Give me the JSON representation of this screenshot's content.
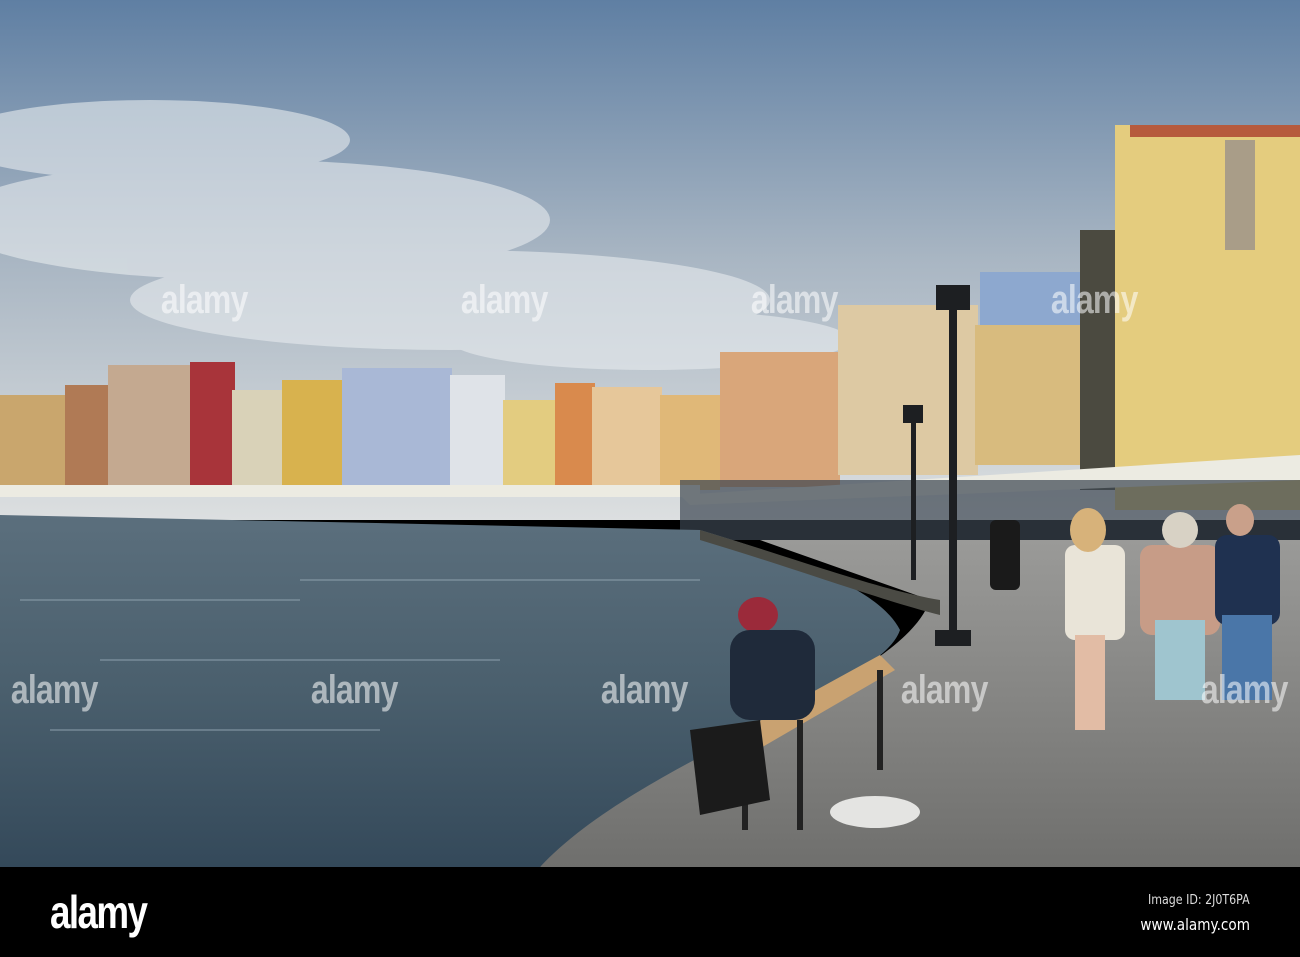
{
  "photo": {
    "watermark": "alamy"
  },
  "footer": {
    "logo": "alamy",
    "image_id": "Image ID: 2J0T6PA",
    "url": "www.alamy.com"
  },
  "colors": {
    "sky_top": "#6f8aaa",
    "sky_bottom": "#d9dfe4",
    "water": "#3f5565",
    "promenade": "#8a8a88"
  }
}
